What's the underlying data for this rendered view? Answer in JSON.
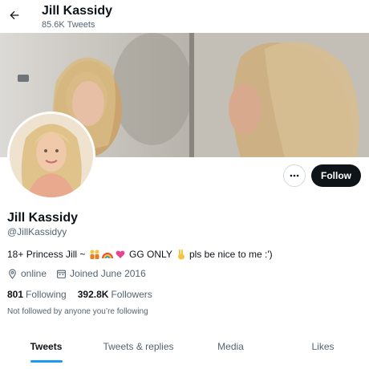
{
  "header": {
    "display_name": "Jill Kassidy",
    "tweet_count": "85.6K Tweets"
  },
  "profile": {
    "display_name": "Jill Kassidy",
    "handle": "@JillKassidyy",
    "bio_parts": [
      "18+ Princess Jill ~ ",
      " GG ONLY ",
      "pls be nice to me :')"
    ],
    "location": "online",
    "joined": "Joined June 2016",
    "following_count": "801",
    "following_label": "Following",
    "followers_count": "392.8K",
    "followers_label": "Followers",
    "followed_note": "Not followed by anyone you’re following"
  },
  "actions": {
    "follow_label": "Follow"
  },
  "tabs": [
    {
      "label": "Tweets",
      "active": true
    },
    {
      "label": "Tweets & replies",
      "active": false
    },
    {
      "label": "Media",
      "active": false
    },
    {
      "label": "Likes",
      "active": false
    }
  ],
  "icons": {
    "back": "arrow-left-icon",
    "more": "more-horizontal-icon",
    "location": "location-pin-icon",
    "calendar": "calendar-icon"
  },
  "colors": {
    "follow_button_bg": "#0f1419",
    "accent": "#1d9bf0",
    "secondary_text": "#536471"
  }
}
